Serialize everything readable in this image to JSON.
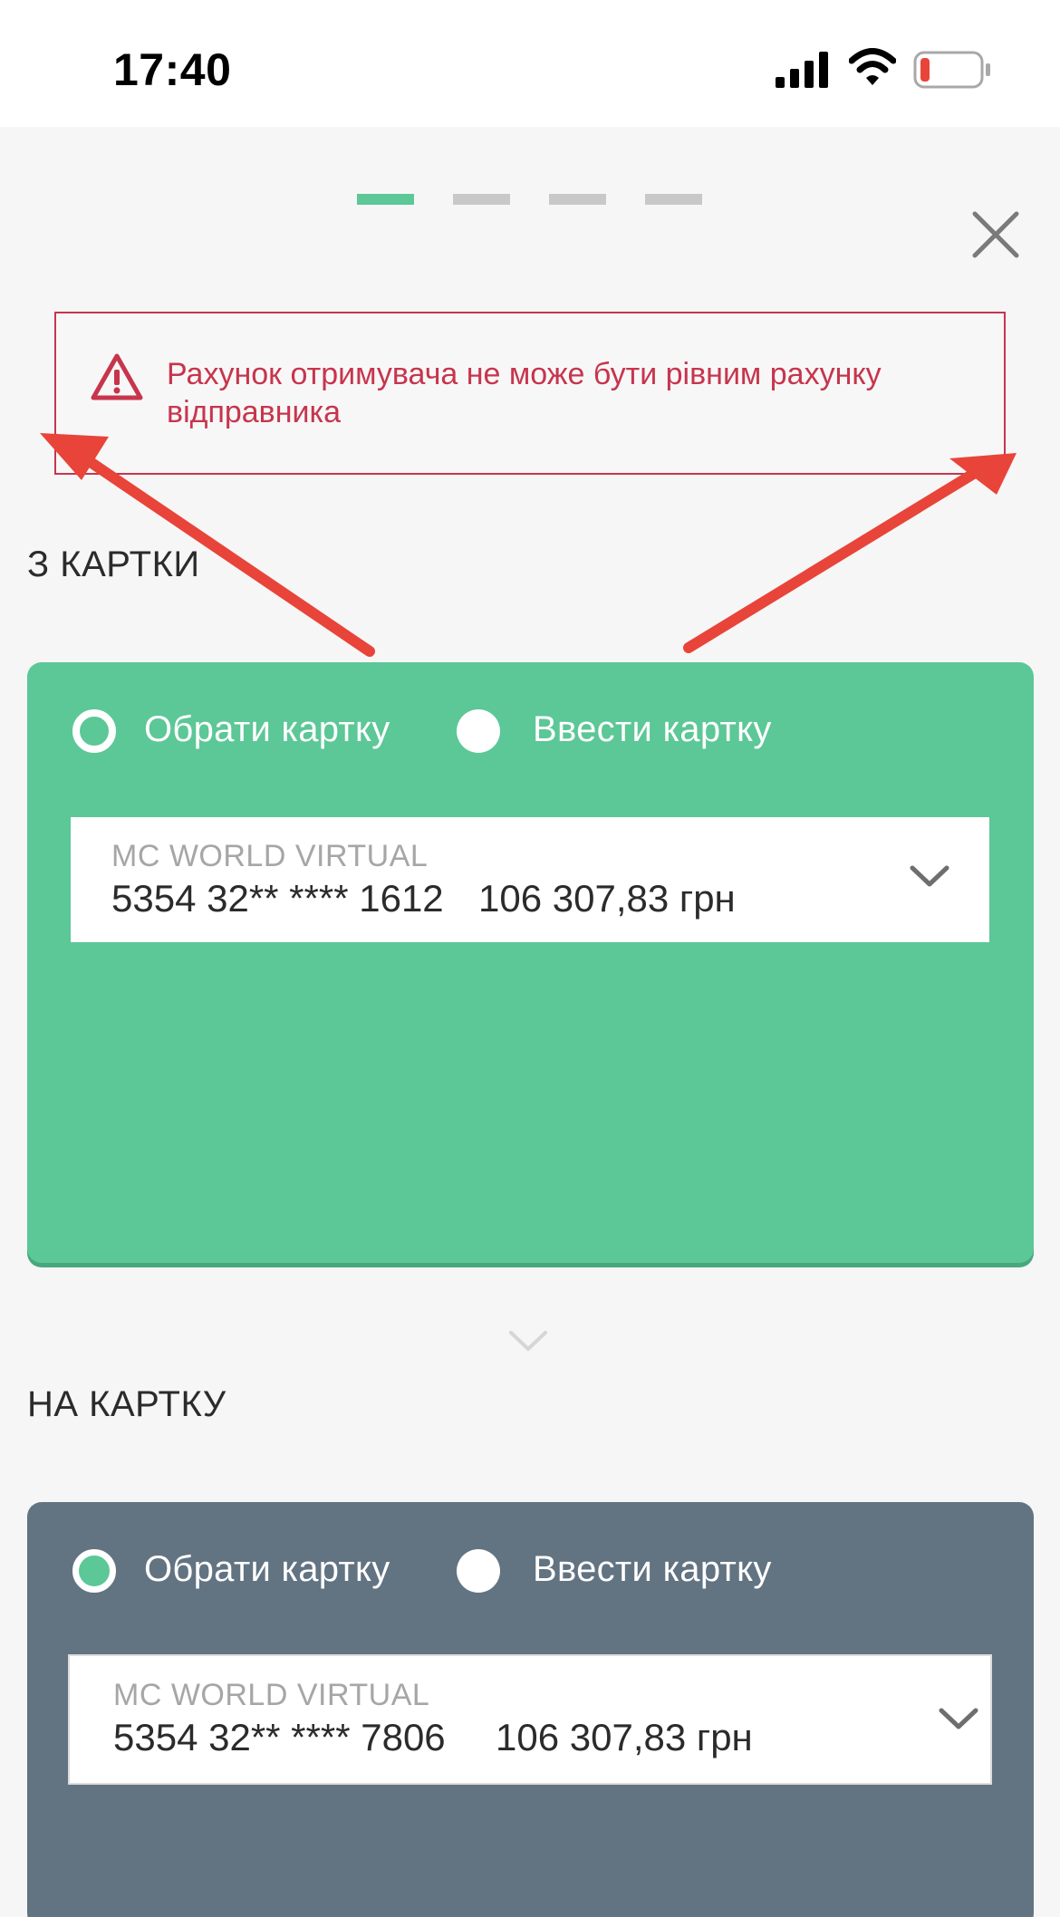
{
  "status_bar": {
    "time": "17:40"
  },
  "stepper": {
    "total_steps": 4,
    "active_step": 1
  },
  "error": {
    "message": "Рахунок отримувача не може бути рівним рахунку відправника"
  },
  "from_section": {
    "title": "З КАРТКИ",
    "options": [
      "Обрати картку",
      "Ввести картку"
    ],
    "selected_option": "Обрати картку",
    "card": {
      "name": "MC WORLD VIRTUAL",
      "number": "5354 32** **** 1612",
      "balance": "106 307,83 грн"
    }
  },
  "to_section": {
    "title": "НА КАРТКУ",
    "options": [
      "Обрати картку",
      "Ввести картку"
    ],
    "selected_option": "Обрати картку",
    "card": {
      "name": "MC WORLD VIRTUAL",
      "number": "5354 32** **** 7806",
      "balance": "106 307,83 грн"
    }
  },
  "colors": {
    "accent": "#5cc797",
    "error": "#c7354d",
    "to_panel": "#627382",
    "annotation_arrow": "#e8443a"
  }
}
